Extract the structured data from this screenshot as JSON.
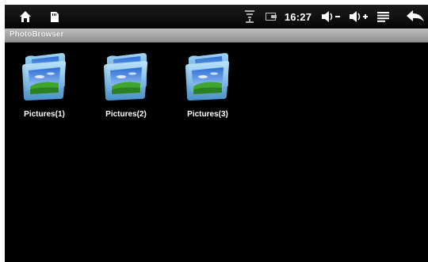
{
  "statusbar": {
    "time": "16:27",
    "icons": [
      "home-icon",
      "sd-card-icon",
      "wifi-icon",
      "battery-icon",
      "volume-down-icon",
      "volume-up-icon",
      "menu-icon",
      "back-icon"
    ]
  },
  "titlebar": {
    "title": "PhotoBrowser"
  },
  "folders": [
    {
      "label": "Pictures(1)"
    },
    {
      "label": "Pictures(2)"
    },
    {
      "label": "Pictures(3)"
    }
  ]
}
